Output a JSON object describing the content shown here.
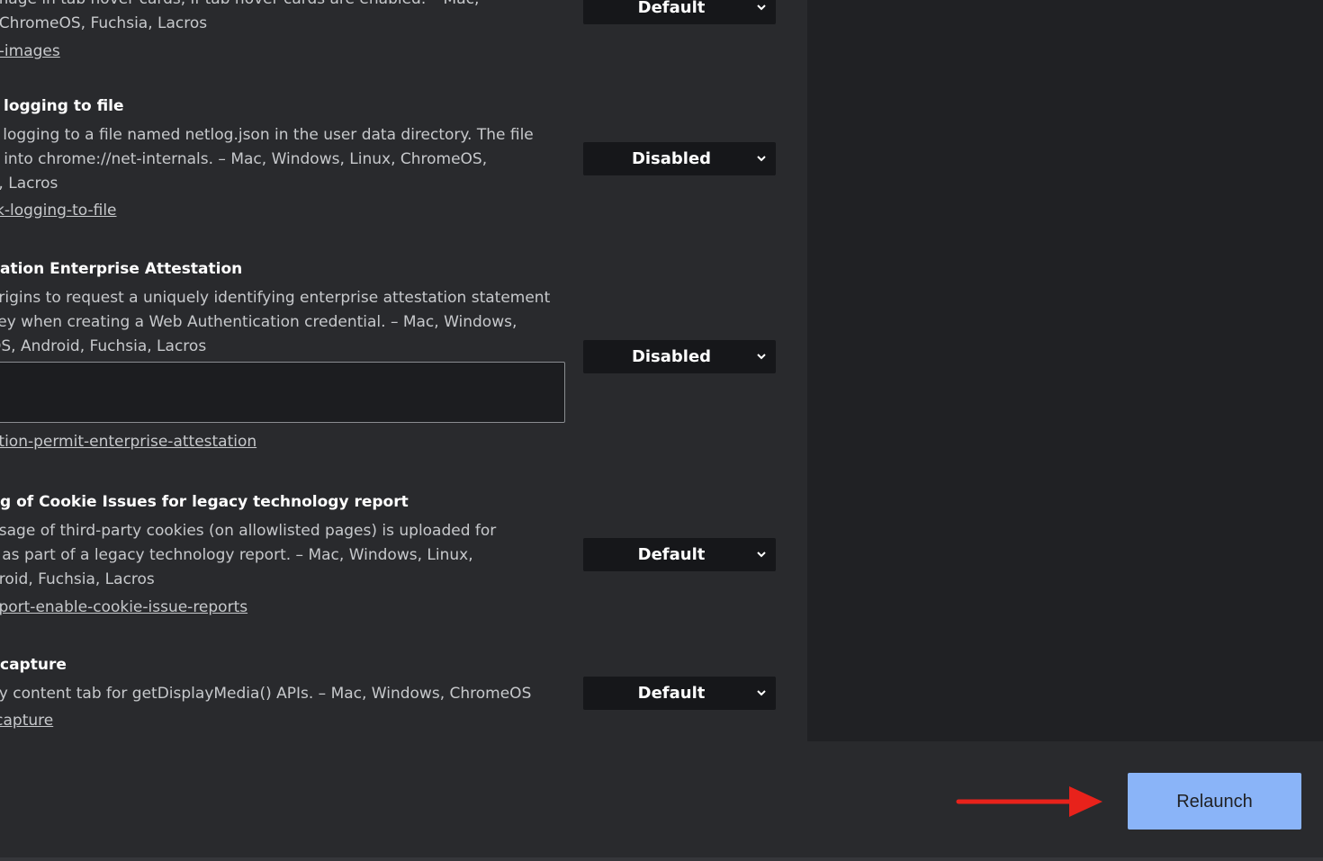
{
  "experiments": [
    {
      "title": "",
      "description": [
        "image in tab hover cards, if tab hover cards are enabled. – Mac,",
        ", ChromeOS, Fuchsia, Lacros"
      ],
      "link": "d-images",
      "select_value": "Default"
    },
    {
      "title": "logging to file",
      "description": [
        "k logging to a file named netlog.json in the user data directory. The file",
        "d into chrome://net-internals. – Mac, Windows, Linux, ChromeOS,",
        "a, Lacros"
      ],
      "link": "rk-logging-to-file",
      "select_value": "Disabled"
    },
    {
      "title": "ation Enterprise Attestation",
      "description": [
        "origins to request a uniquely identifying enterprise attestation statement",
        "key when creating a Web Authentication credential. – Mac, Windows,",
        "OS, Android, Fuchsia, Lacros"
      ],
      "input_value": "",
      "link": "ation-permit-enterprise-attestation",
      "select_value": "Disabled"
    },
    {
      "title": "g of Cookie Issues for legacy technology report",
      "description": [
        "usage of third-party cookies (on allowlisted pages) is uploaded for",
        "s as part of a legacy technology report. – Mac, Windows, Linux,",
        "droid, Fuchsia, Lacros"
      ],
      "link": "eport-enable-cookie-issue-reports",
      "select_value": "Default"
    },
    {
      "title": "capture",
      "description": [
        "by content tab for getDisplayMedia() APIs. – Mac, Windows, ChromeOS"
      ],
      "link": "-capture",
      "select_value": "Default"
    }
  ],
  "relaunch_label": "Relaunch",
  "colors": {
    "background": "#202124",
    "panel": "#292a2d",
    "select_bg": "#16171a",
    "relaunch_bg": "#8ab4f8",
    "annotation_arrow": "#e8221b"
  }
}
